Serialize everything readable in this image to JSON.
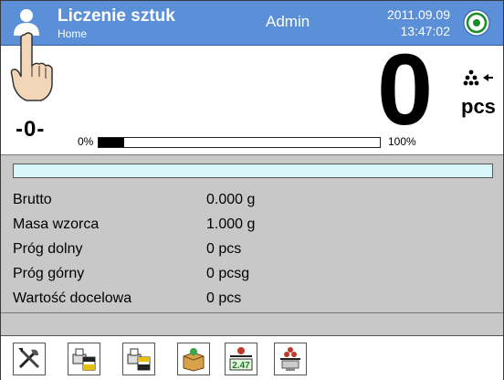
{
  "header": {
    "title": "Liczenie sztuk",
    "subtitle": "Home",
    "user": "Admin",
    "date": "2011.09.09",
    "time": "13:47:02"
  },
  "display": {
    "zero_indicator": "-0-",
    "reading": "0",
    "unit": "pcs",
    "bar_min": "0%",
    "bar_max": "100%",
    "bar_fill_percent": 9
  },
  "info": [
    {
      "label": "Brutto",
      "value": "0.000 g"
    },
    {
      "label": "Masa wzorca",
      "value": "1.000 g"
    },
    {
      "label": "Próg dolny",
      "value": "0 pcs"
    },
    {
      "label": "Próg górny",
      "value": "0 pcsg"
    },
    {
      "label": "Wartość docelowa",
      "value": "0 pcs"
    }
  ],
  "toolbar": {
    "buttons": [
      "settings-icon",
      "print-header-icon",
      "print-footer-icon",
      "database-icon",
      "sample-mass-icon",
      "counting-icon"
    ],
    "sample_mass_value": "2.47"
  },
  "colors": {
    "header_blue": "#5b8fd8",
    "strip_cyan": "#d8f5f8",
    "panel_gray": "#c8c8c8"
  }
}
